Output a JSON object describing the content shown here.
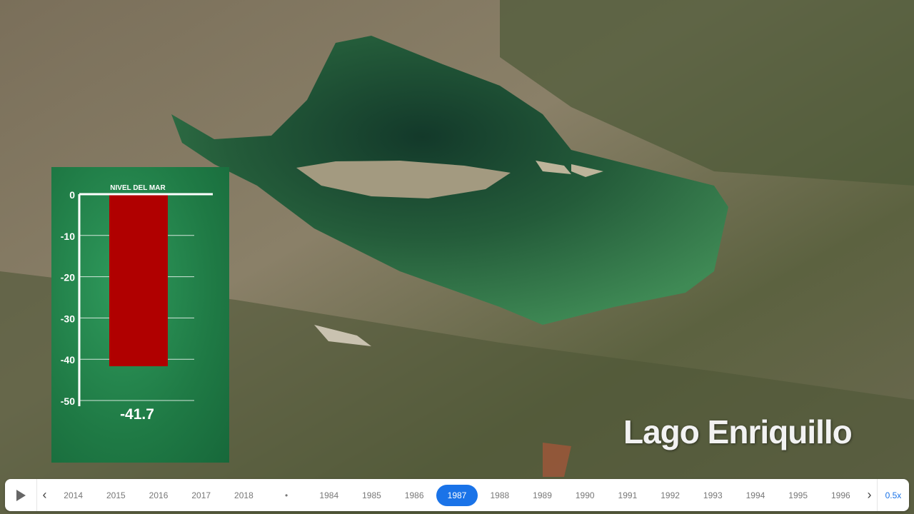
{
  "map": {
    "place_label": "Lago Enriquillo"
  },
  "chart_data": {
    "type": "bar",
    "title": "NIVEL DEL MAR",
    "categories": [
      "1987"
    ],
    "values": [
      -41.7
    ],
    "value_label": "-41.7",
    "ylim": [
      -50,
      0
    ],
    "yticks": [
      "0",
      "-10",
      "-20",
      "-30",
      "-40",
      "-50"
    ],
    "ytick_values": [
      0,
      -10,
      -20,
      -30,
      -40,
      -50
    ],
    "bar_color": "#b00000",
    "grid": true
  },
  "timeline": {
    "years_before": [
      "2014",
      "2015",
      "2016",
      "2017",
      "2018"
    ],
    "separator": "•",
    "years_after": [
      "1984",
      "1985",
      "1986",
      "1987",
      "1988",
      "1989",
      "1990",
      "1991",
      "1992",
      "1993",
      "1994",
      "1995",
      "1996"
    ],
    "selected": "1987",
    "speed": "0.5x",
    "accent": "#1a73e8"
  }
}
